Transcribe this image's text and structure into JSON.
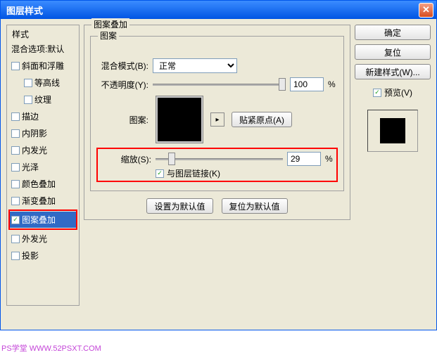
{
  "window": {
    "title": "图层样式"
  },
  "left": {
    "group_label": "样式",
    "blend_default": "混合选项:默认",
    "items": [
      {
        "label": "斜面和浮雕",
        "checked": false
      },
      {
        "label": "等高线",
        "checked": false,
        "sub": true
      },
      {
        "label": "纹理",
        "checked": false,
        "sub": true
      },
      {
        "label": "描边",
        "checked": false
      },
      {
        "label": "内阴影",
        "checked": false
      },
      {
        "label": "内发光",
        "checked": false
      },
      {
        "label": "光泽",
        "checked": false
      },
      {
        "label": "颜色叠加",
        "checked": false
      },
      {
        "label": "渐变叠加",
        "checked": false
      },
      {
        "label": "图案叠加",
        "checked": true,
        "selected": true,
        "highlight": true
      },
      {
        "label": "外发光",
        "checked": false
      },
      {
        "label": "投影",
        "checked": false
      }
    ]
  },
  "middle": {
    "group_label": "图案叠加",
    "inner_label": "图案",
    "blend_mode_label": "混合模式(B):",
    "blend_mode_value": "正常",
    "opacity_label": "不透明度(Y):",
    "opacity_value": "100",
    "percent": "%",
    "pattern_label": "图案:",
    "snap_button": "贴紧原点(A)",
    "scale_label": "缩放(S):",
    "scale_value": "29",
    "link_label": "与图层链接(K)",
    "link_checked": true,
    "set_default": "设置为默认值",
    "reset_default": "复位为默认值"
  },
  "right": {
    "ok": "确定",
    "cancel": "复位",
    "new_style": "新建样式(W)...",
    "preview_label": "预览(V)",
    "preview_checked": true
  },
  "watermark": "PS学堂  WWW.52PSXT.COM"
}
